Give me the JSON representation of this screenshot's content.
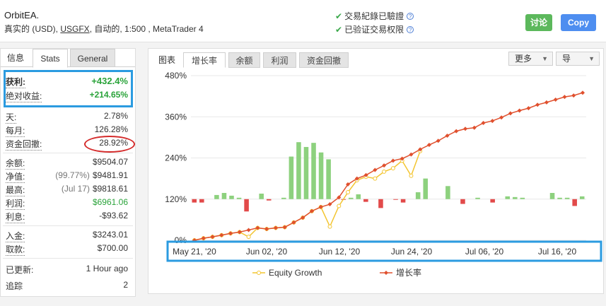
{
  "header": {
    "title": "OrbitEA.",
    "account_type": "真实的 (USD),",
    "broker": "USGFX",
    "details": ", 自动的, 1:500 , MetaTrader 4",
    "verified_track": "交易紀錄已驗證",
    "verified_access": "已验证交易权限",
    "discuss_label": "讨论",
    "copy_label": "Copy"
  },
  "left_tabs": {
    "info": "信息",
    "stats": "Stats",
    "general": "General"
  },
  "stats": {
    "gain_label": "获利:",
    "gain_value": "+432.4%",
    "abs_gain_label": "绝对收益:",
    "abs_gain_value": "+214.65%",
    "daily_label": "天:",
    "daily_value": "2.78%",
    "monthly_label": "每月:",
    "monthly_value": "126.28%",
    "drawdown_label": "资金回撤:",
    "drawdown_value": "28.92%",
    "balance_label": "余额:",
    "balance_value": "$9504.07",
    "equity_label": "净值:",
    "equity_pct": "(99.77%)",
    "equity_value": "$9481.91",
    "highest_label": "最高:",
    "highest_date": "(Jul 17)",
    "highest_value": "$9818.61",
    "profit_label": "利润:",
    "profit_value": "$6961.06",
    "interest_label": "利息:",
    "interest_value": "-$93.62",
    "deposits_label": "入金:",
    "deposits_value": "$3243.01",
    "withdrawals_label": "取款:",
    "withdrawals_value": "$700.00",
    "updated_label": "已更新:",
    "updated_value": "1 Hour ago",
    "tracking_label": "追踪",
    "tracking_value": "2"
  },
  "chart_tabs": {
    "label": "图表",
    "items": [
      "增长率",
      "余额",
      "利润",
      "资金回撤"
    ],
    "active": "增长率",
    "more_label": "更多",
    "export_label": "导"
  },
  "colors": {
    "growth_line": "#e0502e",
    "equity_line": "#f3c531",
    "bar_positive": "#8dd17e",
    "bar_negative": "#e24a4a",
    "annotation_blue": "#2b9be0",
    "annotation_red": "#d42a2a"
  },
  "chart_data": {
    "type": "line",
    "ylim": [
      0,
      480
    ],
    "yticks": [
      "0%",
      "120%",
      "240%",
      "360%",
      "480%"
    ],
    "xticks": [
      "May 21, '20",
      "Jun 02, '20",
      "Jun 12, '20",
      "Jun 24, '20",
      "Jul 06, '20",
      "Jul 16, '20"
    ],
    "series": [
      {
        "name": "Equity Growth",
        "values": [
          0,
          6,
          10,
          15,
          20,
          24,
          10,
          36,
          33,
          36,
          38,
          52,
          66,
          85,
          97,
          40,
          100,
          140,
          175,
          185,
          180,
          200,
          210,
          232,
          188,
          260
        ]
      },
      {
        "name": "增长率",
        "values": [
          0,
          6,
          10,
          15,
          20,
          24,
          30,
          36,
          33,
          36,
          38,
          52,
          66,
          85,
          97,
          105,
          125,
          163,
          180,
          190,
          205,
          218,
          232,
          238,
          250,
          265,
          278,
          290,
          305,
          318,
          325,
          328,
          342,
          348,
          358,
          370,
          378,
          385,
          395,
          402,
          410,
          418,
          422,
          430
        ]
      }
    ],
    "bars_approx": [
      -25,
      -25,
      0,
      30,
      45,
      25,
      10,
      -90,
      0,
      40,
      -10,
      0,
      10,
      310,
      415,
      380,
      410,
      340,
      290,
      0,
      -5,
      10,
      35,
      -20,
      0,
      -65,
      0,
      -5,
      -25,
      0,
      50,
      150,
      0,
      0,
      95,
      0,
      -35,
      0,
      10,
      0,
      -25,
      0,
      20,
      15,
      10,
      0,
      0,
      0,
      45,
      10,
      10,
      -50,
      20
    ]
  }
}
